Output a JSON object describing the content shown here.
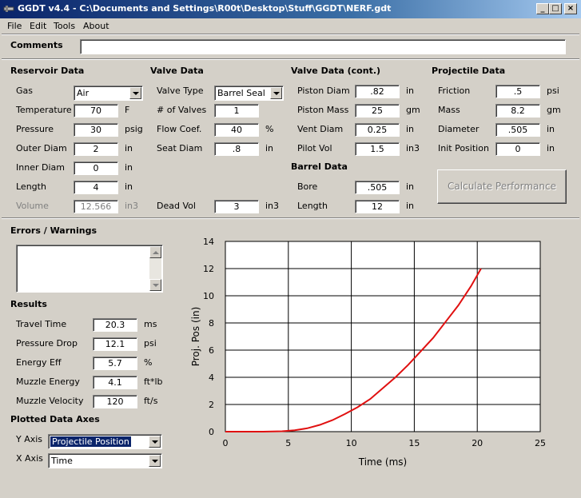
{
  "window": {
    "title": "GGDT v4.4 - C:\\Documents and Settings\\R00t\\Desktop\\Stuff\\GGDT\\NERF.gdt",
    "minimize": "_",
    "maximize": "□",
    "close": "×"
  },
  "menu": [
    "File",
    "Edit",
    "Tools",
    "About"
  ],
  "comments": {
    "label": "Comments",
    "value": ""
  },
  "reservoir": {
    "header": "Reservoir Data",
    "gas": {
      "label": "Gas",
      "value": "Air"
    },
    "temperature": {
      "label": "Temperature",
      "value": "70",
      "unit": "F"
    },
    "pressure": {
      "label": "Pressure",
      "value": "30",
      "unit": "psig"
    },
    "outer_diam": {
      "label": "Outer Diam",
      "value": "2",
      "unit": "in"
    },
    "inner_diam": {
      "label": "Inner Diam",
      "value": "0",
      "unit": "in"
    },
    "length": {
      "label": "Length",
      "value": "4",
      "unit": "in"
    },
    "volume": {
      "label": "Volume",
      "value": "12.566",
      "unit": "in3"
    }
  },
  "valve": {
    "header": "Valve Data",
    "type": {
      "label": "Valve Type",
      "value": "Barrel Seal"
    },
    "num_valves": {
      "label": "# of Valves",
      "value": "1"
    },
    "flow_coef": {
      "label": "Flow Coef.",
      "value": "40",
      "unit": "%"
    },
    "seat_diam": {
      "label": "Seat Diam",
      "value": ".8",
      "unit": "in"
    },
    "dead_vol": {
      "label": "Dead Vol",
      "value": "3",
      "unit": "in3"
    }
  },
  "valve_cont": {
    "header": "Valve Data (cont.)",
    "piston_diam": {
      "label": "Piston Diam",
      "value": ".82",
      "unit": "in"
    },
    "piston_mass": {
      "label": "Piston Mass",
      "value": "25",
      "unit": "gm"
    },
    "vent_diam": {
      "label": "Vent Diam",
      "value": "0.25",
      "unit": "in"
    },
    "pilot_vol": {
      "label": "Pilot Vol",
      "value": "1.5",
      "unit": "in3"
    }
  },
  "barrel": {
    "header": "Barrel Data",
    "bore": {
      "label": "Bore",
      "value": ".505",
      "unit": "in"
    },
    "length": {
      "label": "Length",
      "value": "12",
      "unit": "in"
    }
  },
  "projectile": {
    "header": "Projectile Data",
    "friction": {
      "label": "Friction",
      "value": ".5",
      "unit": "psi"
    },
    "mass": {
      "label": "Mass",
      "value": "8.2",
      "unit": "gm"
    },
    "diameter": {
      "label": "Diameter",
      "value": ".505",
      "unit": "in"
    },
    "init_position": {
      "label": "Init Position",
      "value": "0",
      "unit": "in"
    }
  },
  "calculate_button": "Calculate Performance",
  "errors": {
    "header": "Errors / Warnings",
    "text": ""
  },
  "results": {
    "header": "Results",
    "travel_time": {
      "label": "Travel Time",
      "value": "20.3",
      "unit": "ms"
    },
    "pressure_drop": {
      "label": "Pressure Drop",
      "value": "12.1",
      "unit": "psi"
    },
    "energy_eff": {
      "label": "Energy Eff",
      "value": "5.7",
      "unit": "%"
    },
    "muzzle_energy": {
      "label": "Muzzle Energy",
      "value": "4.1",
      "unit": "ft*lb"
    },
    "muzzle_velocity": {
      "label": "Muzzle Velocity",
      "value": "120",
      "unit": "ft/s"
    }
  },
  "plot_axes": {
    "header": "Plotted Data Axes",
    "y_axis": {
      "label": "Y Axis",
      "value": "Projectile Position"
    },
    "x_axis": {
      "label": "X Axis",
      "value": "Time"
    }
  },
  "colors": {
    "curve": "#e01010",
    "title_bar": "#0a246a",
    "face": "#d4d0c8"
  },
  "chart_data": {
    "type": "line",
    "xlabel": "Time (ms)",
    "ylabel": "Proj. Pos (in)",
    "xlim": [
      0,
      25
    ],
    "ylim": [
      0,
      14
    ],
    "x_ticks": [
      0,
      5,
      10,
      15,
      20,
      25
    ],
    "y_ticks": [
      0,
      2,
      4,
      6,
      8,
      10,
      12,
      14
    ],
    "grid": true,
    "series": [
      {
        "x": [
          0,
          3,
          4.5,
          5.5,
          6.5,
          7.5,
          8.5,
          9.5,
          10.5,
          11.5,
          12.5,
          13.5,
          14.5,
          15.5,
          16.5,
          17.5,
          18.5,
          19.5,
          20.3
        ],
        "y": [
          0,
          0,
          0.03,
          0.1,
          0.25,
          0.5,
          0.85,
          1.3,
          1.8,
          2.4,
          3.2,
          4.0,
          4.9,
          5.9,
          6.9,
          8.1,
          9.3,
          10.7,
          12.0
        ]
      }
    ]
  }
}
